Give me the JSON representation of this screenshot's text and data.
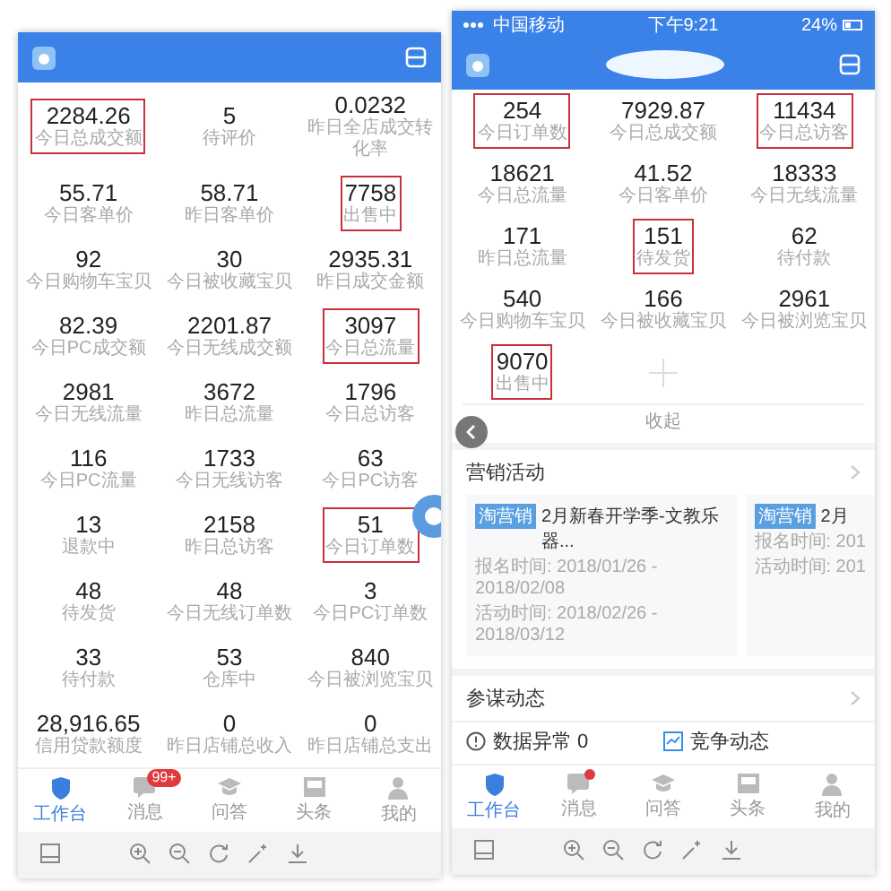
{
  "left_screen": {
    "stats": [
      {
        "value": "2284.26",
        "label": "今日总成交额",
        "highlighted": true
      },
      {
        "value": "5",
        "label": "待评价",
        "highlighted": false
      },
      {
        "value": "0.0232",
        "label": "昨日全店成交转化率",
        "highlighted": false
      },
      {
        "value": "55.71",
        "label": "今日客单价",
        "highlighted": false
      },
      {
        "value": "58.71",
        "label": "昨日客单价",
        "highlighted": false
      },
      {
        "value": "7758",
        "label": "出售中",
        "highlighted": true
      },
      {
        "value": "92",
        "label": "今日购物车宝贝",
        "highlighted": false
      },
      {
        "value": "30",
        "label": "今日被收藏宝贝",
        "highlighted": false
      },
      {
        "value": "2935.31",
        "label": "昨日成交金额",
        "highlighted": false
      },
      {
        "value": "82.39",
        "label": "今日PC成交额",
        "highlighted": false
      },
      {
        "value": "2201.87",
        "label": "今日无线成交额",
        "highlighted": false
      },
      {
        "value": "3097",
        "label": "今日总流量",
        "highlighted": true
      },
      {
        "value": "2981",
        "label": "今日无线流量",
        "highlighted": false
      },
      {
        "value": "3672",
        "label": "昨日总流量",
        "highlighted": false
      },
      {
        "value": "1796",
        "label": "今日总访客",
        "highlighted": false
      },
      {
        "value": "116",
        "label": "今日PC流量",
        "highlighted": false
      },
      {
        "value": "1733",
        "label": "今日无线访客",
        "highlighted": false
      },
      {
        "value": "63",
        "label": "今日PC访客",
        "highlighted": false
      },
      {
        "value": "13",
        "label": "退款中",
        "highlighted": false
      },
      {
        "value": "2158",
        "label": "昨日总访客",
        "highlighted": false
      },
      {
        "value": "51",
        "label": "今日订单数",
        "highlighted": true
      },
      {
        "value": "48",
        "label": "待发货",
        "highlighted": false
      },
      {
        "value": "48",
        "label": "今日无线订单数",
        "highlighted": false
      },
      {
        "value": "3",
        "label": "今日PC订单数",
        "highlighted": false
      },
      {
        "value": "33",
        "label": "待付款",
        "highlighted": false
      },
      {
        "value": "53",
        "label": "仓库中",
        "highlighted": false
      },
      {
        "value": "840",
        "label": "今日被浏览宝贝",
        "highlighted": false
      },
      {
        "value": "28,916.65",
        "label": "信用贷款额度",
        "highlighted": false
      },
      {
        "value": "0",
        "label": "昨日店铺总收入",
        "highlighted": false
      },
      {
        "value": "0",
        "label": "昨日店铺总支出",
        "highlighted": false
      }
    ],
    "tab_bar": [
      {
        "label": "工作台",
        "selected": true
      },
      {
        "label": "消息",
        "selected": false,
        "badge": "99+"
      },
      {
        "label": "问答",
        "selected": false
      },
      {
        "label": "头条",
        "selected": false
      },
      {
        "label": "我的",
        "selected": false
      }
    ]
  },
  "right_screen": {
    "status_bar": {
      "carrier": "中国移动",
      "time": "下午9:21",
      "battery": "24%"
    },
    "stats": [
      {
        "value": "254",
        "label": "今日订单数",
        "highlighted": true
      },
      {
        "value": "7929.87",
        "label": "今日总成交额",
        "highlighted": false
      },
      {
        "value": "11434",
        "label": "今日总访客",
        "highlighted": true
      },
      {
        "value": "18621",
        "label": "今日总流量",
        "highlighted": false
      },
      {
        "value": "41.52",
        "label": "今日客单价",
        "highlighted": false
      },
      {
        "value": "18333",
        "label": "今日无线流量",
        "highlighted": false
      },
      {
        "value": "171",
        "label": "昨日总流量",
        "highlighted": false
      },
      {
        "value": "151",
        "label": "待发货",
        "highlighted": true
      },
      {
        "value": "62",
        "label": "待付款",
        "highlighted": false
      },
      {
        "value": "540",
        "label": "今日购物车宝贝",
        "highlighted": false
      },
      {
        "value": "166",
        "label": "今日被收藏宝贝",
        "highlighted": false
      },
      {
        "value": "2961",
        "label": "今日被浏览宝贝",
        "highlighted": false
      },
      {
        "value": "9070",
        "label": "出售中",
        "highlighted": true
      }
    ],
    "collapse": "收起",
    "marketing": {
      "title": "营销活动",
      "cards": [
        {
          "tag": "淘营销",
          "title": "2月新春开学季-文教乐器...",
          "signup": "报名时间: 2018/01/26 - 2018/02/08",
          "period": "活动时间: 2018/02/26 - 2018/03/12"
        },
        {
          "tag": "淘营销",
          "title": "2月",
          "signup": "报名时间: 201",
          "period": "活动时间: 201"
        }
      ]
    },
    "advisor": {
      "title": "参谋动态",
      "items": [
        {
          "kind": "alert",
          "label": "数据异常 0"
        },
        {
          "kind": "trend",
          "label": "竞争动态"
        }
      ]
    },
    "tab_bar": [
      {
        "label": "工作台",
        "selected": true,
        "dot": false
      },
      {
        "label": "消息",
        "selected": false,
        "dot": true
      },
      {
        "label": "问答",
        "selected": false,
        "dot": false
      },
      {
        "label": "头条",
        "selected": false,
        "dot": false
      },
      {
        "label": "我的",
        "selected": false,
        "dot": false
      }
    ]
  }
}
